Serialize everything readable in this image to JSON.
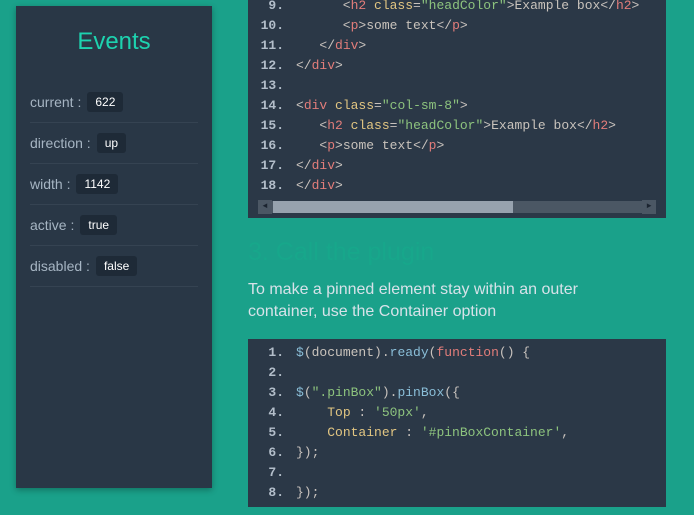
{
  "sidebar": {
    "title": "Events",
    "rows": [
      {
        "label": "current :",
        "value": "622"
      },
      {
        "label": "direction :",
        "value": "up"
      },
      {
        "label": "width :",
        "value": "1142"
      },
      {
        "label": "active :",
        "value": "true"
      },
      {
        "label": "disabled :",
        "value": "false"
      }
    ]
  },
  "code1": {
    "start": 9,
    "tokens": [
      [
        [
          "br",
          "      <"
        ],
        [
          "tg",
          "h2"
        ],
        [
          "br",
          " "
        ],
        [
          "at",
          "class"
        ],
        [
          "br",
          "="
        ],
        [
          "st",
          "\"headColor\""
        ],
        [
          "br",
          ">"
        ],
        [
          "tx",
          "Example box"
        ],
        [
          "br",
          "</"
        ],
        [
          "tg",
          "h2"
        ],
        [
          "br",
          ">"
        ]
      ],
      [
        [
          "br",
          "      <"
        ],
        [
          "tg",
          "p"
        ],
        [
          "br",
          ">"
        ],
        [
          "tx",
          "some text"
        ],
        [
          "br",
          "</"
        ],
        [
          "tg",
          "p"
        ],
        [
          "br",
          ">"
        ]
      ],
      [
        [
          "br",
          "   </"
        ],
        [
          "tg",
          "div"
        ],
        [
          "br",
          ">"
        ]
      ],
      [
        [
          "br",
          "</"
        ],
        [
          "tg",
          "div"
        ],
        [
          "br",
          ">"
        ]
      ],
      [],
      [
        [
          "br",
          "<"
        ],
        [
          "tg",
          "div"
        ],
        [
          "br",
          " "
        ],
        [
          "at",
          "class"
        ],
        [
          "br",
          "="
        ],
        [
          "st",
          "\"col-sm-8\""
        ],
        [
          "br",
          ">"
        ]
      ],
      [
        [
          "br",
          "   <"
        ],
        [
          "tg",
          "h2"
        ],
        [
          "br",
          " "
        ],
        [
          "at",
          "class"
        ],
        [
          "br",
          "="
        ],
        [
          "st",
          "\"headColor\""
        ],
        [
          "br",
          ">"
        ],
        [
          "tx",
          "Example box"
        ],
        [
          "br",
          "</"
        ],
        [
          "tg",
          "h2"
        ],
        [
          "br",
          ">"
        ]
      ],
      [
        [
          "br",
          "   <"
        ],
        [
          "tg",
          "p"
        ],
        [
          "br",
          ">"
        ],
        [
          "tx",
          "some text"
        ],
        [
          "br",
          "</"
        ],
        [
          "tg",
          "p"
        ],
        [
          "br",
          ">"
        ]
      ],
      [
        [
          "br",
          "</"
        ],
        [
          "tg",
          "div"
        ],
        [
          "br",
          ">"
        ]
      ],
      [
        [
          "br",
          "</"
        ],
        [
          "tg",
          "div"
        ],
        [
          "br",
          ">"
        ]
      ]
    ]
  },
  "section": {
    "heading": "3. Call the plugin",
    "desc": "To make a pinned element stay within an outer container, use the Container option"
  },
  "code2": {
    "start": 1,
    "tokens": [
      [
        [
          "fn",
          "$"
        ],
        [
          "op",
          "("
        ],
        [
          "vr",
          "document"
        ],
        [
          "op",
          ")."
        ],
        [
          "fn",
          "ready"
        ],
        [
          "op",
          "("
        ],
        [
          "kw",
          "function"
        ],
        [
          "op",
          "() {"
        ]
      ],
      [],
      [
        [
          "fn",
          "$"
        ],
        [
          "op",
          "("
        ],
        [
          "st",
          "\".pinBox\""
        ],
        [
          "op",
          ")."
        ],
        [
          "fn",
          "pinBox"
        ],
        [
          "op",
          "({"
        ]
      ],
      [
        [
          "op",
          "    "
        ],
        [
          "pr",
          "Top"
        ],
        [
          "op",
          " : "
        ],
        [
          "st",
          "'50px'"
        ],
        [
          "op",
          ","
        ]
      ],
      [
        [
          "op",
          "    "
        ],
        [
          "pr",
          "Container"
        ],
        [
          "op",
          " : "
        ],
        [
          "st",
          "'#pinBoxContainer'"
        ],
        [
          "op",
          ","
        ]
      ],
      [
        [
          "op",
          "});"
        ]
      ],
      [],
      [
        [
          "op",
          "});"
        ]
      ]
    ]
  }
}
